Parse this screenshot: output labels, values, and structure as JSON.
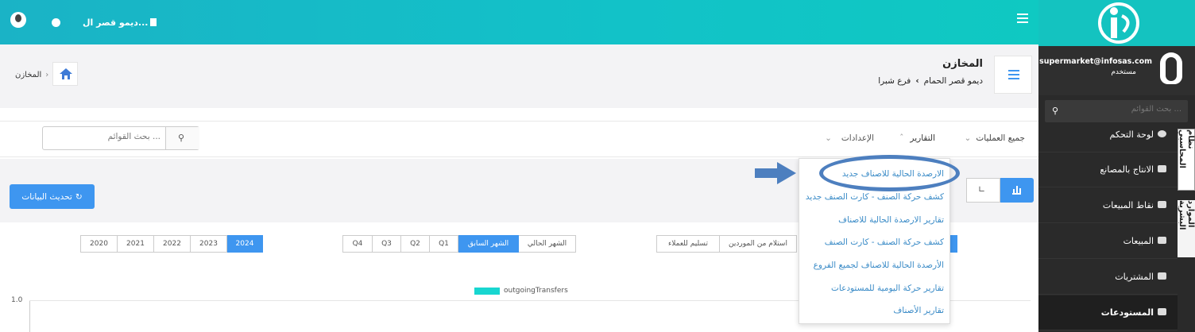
{
  "topbar": {
    "company_label": "ديمو قصر ال...",
    "menu_icon": "hamburger-icon",
    "globe_icon": "globe-icon",
    "user_icon": "user-avatar-icon",
    "store_icon": "store-icon"
  },
  "header": {
    "title": "المخازن",
    "breadcrumb_company": "ديمو قصر الحمام",
    "breadcrumb_branch": "فرع شبرا",
    "left_crumb": "المخازن",
    "menu_icon": "list-icon",
    "home_icon": "home-icon"
  },
  "user": {
    "email": "supermarket@infosas.com",
    "role": "مستخدم"
  },
  "sidebar": {
    "search_placeholder": "بحث القوائم ...",
    "items": [
      {
        "label": "لوحة التحكم",
        "icon": "dashboard-icon"
      },
      {
        "label": "الانتاج بالمصانع",
        "icon": "factory-icon"
      },
      {
        "label": "نقاط المبيعات",
        "icon": "pos-icon"
      },
      {
        "label": "المبيعات",
        "icon": "truck-icon"
      },
      {
        "label": "المشتريات",
        "icon": "purchases-icon"
      },
      {
        "label": "المستودعات",
        "icon": "warehouse-icon"
      }
    ],
    "tabs": [
      "نظام المحاسبي",
      "الموارد البشرية"
    ]
  },
  "toolbar": {
    "menu_all_ops": "جميع العمليات",
    "menu_reports": "التقارير",
    "menu_settings": "الإعدادات",
    "search_placeholder": "بحث القوائم ..."
  },
  "dropdown": {
    "items": [
      "الارصدة الحالية للاصناف جديد",
      "كشف حركة الصنف - كارت الصنف جديد",
      "تقارير الارصدة الحالية للاصناف",
      "كشف حركة الصنف - كارت الصنف",
      "الأرصدة الحالية للاصناف لجميع الفروع",
      "تقارير حركة اليومية للمستودعات",
      "تقارير الأصناف"
    ]
  },
  "refresh_button": "تحديث البيانات",
  "filters": {
    "types": [
      "استلام من الموردين",
      "تسليم للعملاء"
    ],
    "periods": [
      "الشهر الحالي",
      "الشهر السابق",
      "Q1",
      "Q2",
      "Q3",
      "Q4"
    ],
    "active_period": "الشهر السابق",
    "years": [
      "2024",
      "2023",
      "2022",
      "2021",
      "2020"
    ],
    "active_year": "2024"
  },
  "chart_data": {
    "type": "bar",
    "legend": [
      "outgoingTransfers"
    ],
    "y_tick_top": "1.0",
    "legend_color": "#18d6d0",
    "series": []
  },
  "colors": {
    "accent": "#1ab3c6",
    "primary": "#3e96f0",
    "sidebar": "#2a2a2a"
  }
}
